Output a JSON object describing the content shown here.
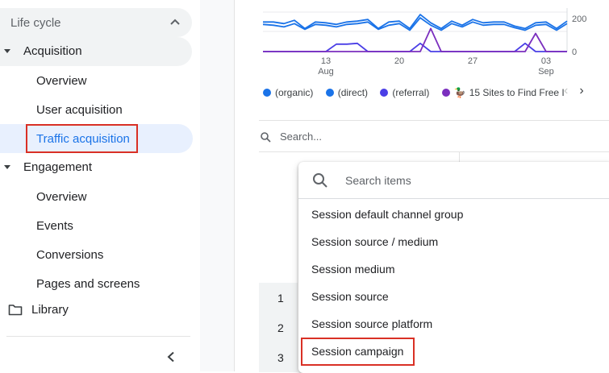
{
  "sidebar": {
    "section_title": "Life cycle",
    "acquisition": {
      "label": "Acquisition",
      "items": [
        "Overview",
        "User acquisition",
        "Traffic acquisition"
      ]
    },
    "engagement": {
      "label": "Engagement",
      "items": [
        "Overview",
        "Events",
        "Conversions",
        "Pages and screens"
      ]
    },
    "library_label": "Library",
    "active_item": "Traffic acquisition"
  },
  "chart_data": {
    "type": "line",
    "x": [
      "Aug 7",
      "Aug 8",
      "Aug 9",
      "Aug 10",
      "Aug 11",
      "Aug 12",
      "Aug 13",
      "Aug 14",
      "Aug 15",
      "Aug 16",
      "Aug 17",
      "Aug 18",
      "Aug 19",
      "Aug 20",
      "Aug 21",
      "Aug 22",
      "Aug 23",
      "Aug 24",
      "Aug 25",
      "Aug 26",
      "Aug 27",
      "Aug 28",
      "Aug 29",
      "Aug 30",
      "Aug 31",
      "Sep 1",
      "Sep 2",
      "Sep 3",
      "Sep 4",
      "Sep 5"
    ],
    "x_tick_labels": [
      {
        "day": "13",
        "month": "Aug"
      },
      {
        "day": "20",
        "month": ""
      },
      {
        "day": "27",
        "month": ""
      },
      {
        "day": "03",
        "month": "Sep"
      }
    ],
    "y_ticks": [
      "200",
      "0"
    ],
    "ylim": [
      0,
      240
    ],
    "series": [
      {
        "name": "(organic)",
        "color": "#1a73e8",
        "values": [
          180,
          180,
          170,
          190,
          140,
          180,
          175,
          165,
          180,
          185,
          195,
          140,
          180,
          185,
          140,
          225,
          175,
          140,
          185,
          160,
          195,
          175,
          180,
          180,
          155,
          140,
          175,
          180,
          140,
          185
        ]
      },
      {
        "name": "(direct)",
        "color": "#1a73e8",
        "values": [
          165,
          160,
          150,
          170,
          135,
          165,
          160,
          150,
          165,
          170,
          180,
          135,
          160,
          170,
          130,
          205,
          160,
          130,
          170,
          150,
          180,
          160,
          165,
          165,
          145,
          130,
          160,
          165,
          130,
          170
        ]
      },
      {
        "name": "(referral)",
        "color": "#4a3ee6",
        "values": [
          0,
          0,
          0,
          0,
          0,
          0,
          0,
          45,
          45,
          50,
          0,
          0,
          0,
          0,
          0,
          50,
          0,
          0,
          0,
          0,
          0,
          0,
          0,
          0,
          0,
          50,
          0,
          0,
          0,
          0
        ]
      },
      {
        "name": "15 Sites to Find Free I",
        "color": "#7b2fbe",
        "values": [
          0,
          0,
          0,
          0,
          0,
          0,
          0,
          0,
          0,
          0,
          0,
          0,
          0,
          0,
          0,
          0,
          140,
          0,
          0,
          0,
          0,
          0,
          0,
          0,
          0,
          0,
          110,
          0,
          0,
          0
        ]
      }
    ]
  },
  "legend": {
    "items": [
      {
        "label": "(organic)",
        "color": "#1a73e8"
      },
      {
        "label": "(direct)",
        "color": "#1a73e8"
      },
      {
        "label": "(referral)",
        "color": "#4a3ee6"
      },
      {
        "label": "15 Sites to Find Free I",
        "color": "#7b2fbe",
        "prefix_glyph": "🦆"
      }
    ]
  },
  "table": {
    "search_placeholder": "Search...",
    "row_numbers": [
      "1",
      "2",
      "3"
    ]
  },
  "dropdown": {
    "search_placeholder": "Search items",
    "items": [
      "Session default channel group",
      "Session source / medium",
      "Session medium",
      "Session source",
      "Session source platform",
      "Session campaign"
    ],
    "highlighted_item": "Session campaign"
  },
  "colors": {
    "accent": "#1a73e8",
    "highlight_border": "#d93025",
    "active_bg": "#e8f0fe"
  }
}
